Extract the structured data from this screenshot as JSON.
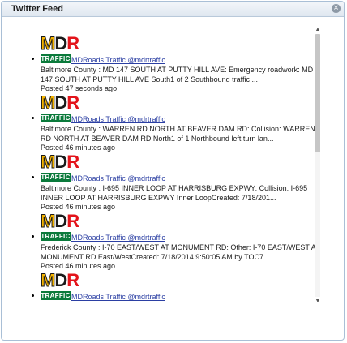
{
  "window": {
    "title": "Twitter Feed",
    "close_symbol": "×"
  },
  "logo": {
    "m": "M",
    "d": "D",
    "r": "R",
    "traffic": "TRAFFIC",
    "colors": {
      "m": "#f5b400",
      "d": "#1a1a1a",
      "r": "#e3141b",
      "traffic_bg": "#0a7a3b"
    }
  },
  "feed": [
    {
      "handle": "MDRoads Traffic @mdrtraffic",
      "text": "Baltimore County : MD 147 SOUTH AT PUTTY HILL AVE: Emergency roadwork: MD 147 SOUTH AT PUTTY HILL AVE South1 of 2 Southbound traffic ...",
      "posted": "Posted 47 seconds ago"
    },
    {
      "handle": "MDRoads Traffic @mdrtraffic",
      "text": "Baltimore County : WARREN RD NORTH AT BEAVER DAM RD: Collision: WARREN RD NORTH AT BEAVER DAM RD North1 of 1 Northbound left turn lan...",
      "posted": "Posted 46 minutes ago"
    },
    {
      "handle": "MDRoads Traffic @mdrtraffic",
      "text": "Baltimore County : I-695 INNER LOOP AT HARRISBURG EXPWY: Collision: I-695 INNER LOOP AT HARRISBURG EXPWY Inner LoopCreated: 7/18/201...",
      "posted": "Posted 46 minutes ago"
    },
    {
      "handle": "MDRoads Traffic @mdrtraffic",
      "text": "Frederick County : I-70 EAST/WEST AT MONUMENT RD: Other: I-70 EAST/WEST AT MONUMENT RD East/WestCreated: 7/18/2014 9:50:05 AM by TOC7.",
      "posted": "Posted 46 minutes ago"
    },
    {
      "handle": "MDRoads Traffic @mdrtraffic",
      "text": "",
      "posted": ""
    }
  ],
  "scrollbar": {
    "up_symbol": "▲",
    "down_symbol": "▼",
    "position_fraction": 0.0,
    "visible_fraction": 0.45
  }
}
